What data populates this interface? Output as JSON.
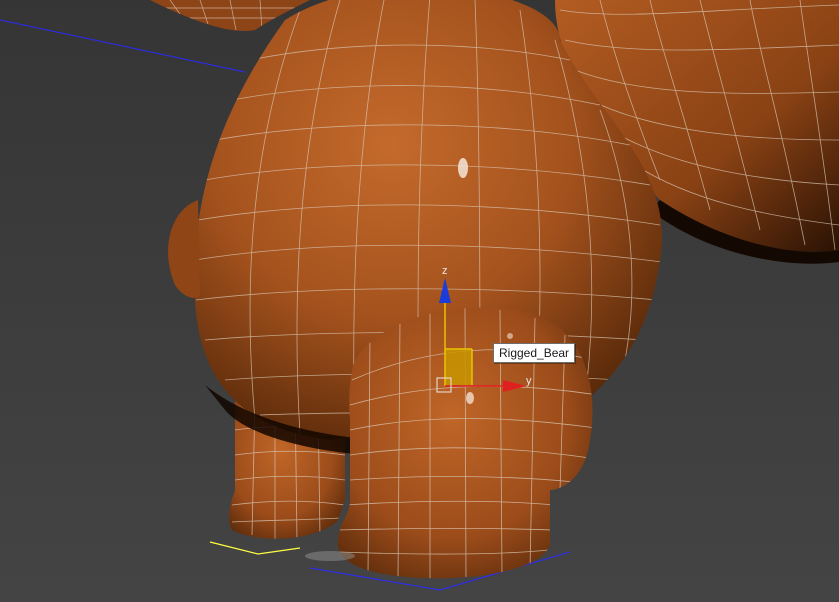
{
  "scene": {
    "selected_object_tooltip": "Rigged_Bear",
    "gizmo_axis_labels": {
      "z": "z",
      "y": "y"
    }
  },
  "colors": {
    "background": "#3c3c3c",
    "mesh_body": "#a4521d",
    "mesh_highlight": "#c8692a",
    "wireframe": "#d8c7b4",
    "axis_x": "#e02020",
    "axis_y": "#e02020",
    "axis_z": "#1a3cd8",
    "axis_plane": "#e8c400",
    "grid_line": "#2424ff",
    "selection_bracket": "#ffff40"
  }
}
